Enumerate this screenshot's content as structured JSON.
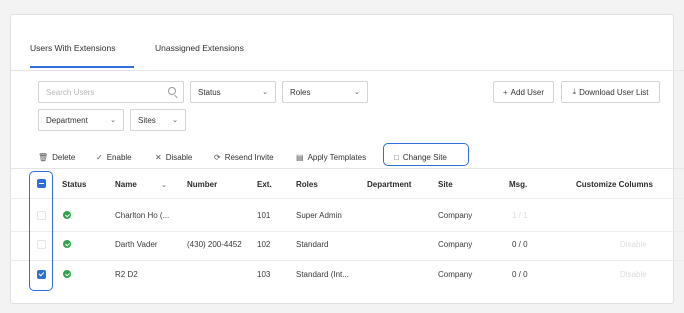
{
  "tabs": [
    {
      "label": "Users With Extensions",
      "active": true
    },
    {
      "label": "Unassigned Extensions",
      "active": false
    }
  ],
  "filters": {
    "search_placeholder": "Search Users",
    "status_label": "Status",
    "roles_label": "Roles",
    "department_label": "Department",
    "sites_label": "Sites"
  },
  "actions": {
    "add_user": "Add User",
    "download_user_list": "Download User List"
  },
  "toolbar": {
    "delete": "Delete",
    "enable": "Enable",
    "disable": "Disable",
    "resend_invite": "Resend Invite",
    "apply_templates": "Apply Templates",
    "change_site": "Change Site"
  },
  "table": {
    "columns": [
      "Status",
      "Name",
      "Number",
      "Ext.",
      "Roles",
      "Department",
      "Site",
      "Msg.",
      "Customize Columns"
    ],
    "rows": [
      {
        "checked": false,
        "status": "active",
        "name": "Charlton Ho (...",
        "number": "",
        "ext": "101",
        "role": "Super Admin",
        "department": "",
        "site": "Company",
        "msg": "1 / 1",
        "extra": ""
      },
      {
        "checked": false,
        "status": "active",
        "name": "Darth Vader",
        "number": "(430) 200-4452",
        "ext": "102",
        "role": "Standard",
        "department": "",
        "site": "Company",
        "msg": "0 / 0",
        "extra": "Disable"
      },
      {
        "checked": true,
        "status": "active",
        "name": "R2 D2",
        "number": "",
        "ext": "103",
        "role": "Standard (Int...",
        "department": "",
        "site": "Company",
        "msg": "0 / 0",
        "extra": "Disable"
      }
    ]
  },
  "colors": {
    "accent": "#2e6fd8",
    "status_active": "#2ea34a"
  }
}
